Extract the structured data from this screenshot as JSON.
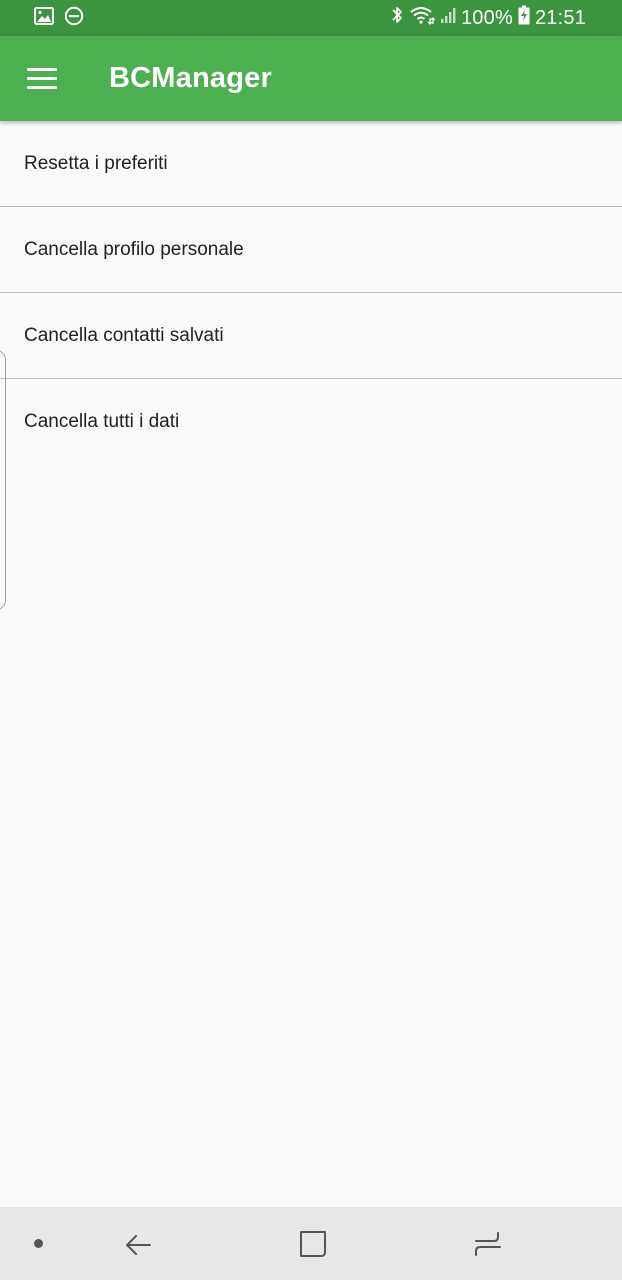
{
  "status_bar": {
    "battery": "100%",
    "time": "21:51",
    "icons": [
      "gallery-icon",
      "do-not-disturb-icon",
      "bluetooth-icon",
      "wifi-icon",
      "signal-icon",
      "battery-charging-icon"
    ]
  },
  "app_bar": {
    "title": "BCManager",
    "menu_icon": "hamburger-menu-icon",
    "color": "#4caf50",
    "status_color": "#3a9440"
  },
  "list": {
    "items": [
      {
        "label": "Resetta i preferiti"
      },
      {
        "label": "Cancella profilo personale"
      },
      {
        "label": "Cancella contatti salvati"
      },
      {
        "label": "Cancella tutti i dati"
      }
    ]
  },
  "nav_bar": {
    "buttons": [
      "home-dot-icon",
      "back-icon",
      "overview-icon",
      "recent-apps-icon"
    ]
  }
}
